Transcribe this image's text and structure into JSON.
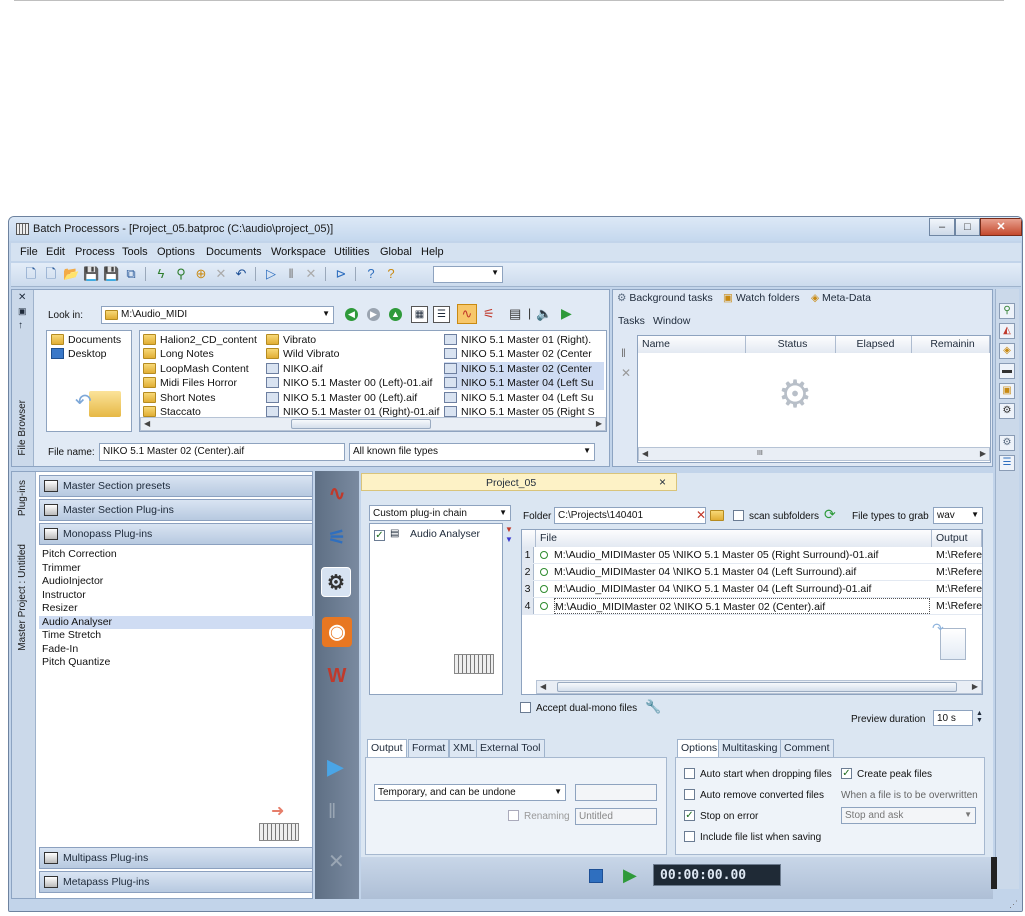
{
  "window": {
    "title": "Batch Processors - [Project_05.batproc (C:\\audio\\project_05)]",
    "min": "–",
    "max": "□",
    "close": "✕"
  },
  "menu": [
    "File",
    "Edit",
    "Process",
    "Tools",
    "Options",
    "Documents",
    "Workspace",
    "Utilities",
    "Global",
    "Help"
  ],
  "file_browser": {
    "vtab": "File Browser",
    "look_in_label": "Look in:",
    "look_in_value": "M:\\Audio_MIDI",
    "left_items": [
      "Documents",
      "Desktop"
    ],
    "col1": [
      {
        "name": "Halion2_CD_content",
        "type": "folder"
      },
      {
        "name": "Long Notes",
        "type": "folder"
      },
      {
        "name": "LoopMash Content",
        "type": "folder"
      },
      {
        "name": "Midi Files Horror",
        "type": "folder"
      },
      {
        "name": "Short Notes",
        "type": "folder"
      },
      {
        "name": "Staccato",
        "type": "folder"
      }
    ],
    "col2": [
      {
        "name": "Vibrato",
        "type": "folder"
      },
      {
        "name": "Wild Vibrato",
        "type": "folder"
      },
      {
        "name": "NIKO.aif",
        "type": "aif"
      },
      {
        "name": "NIKO 5.1 Master 00 (Left)-01.aif",
        "type": "aif"
      },
      {
        "name": "NIKO 5.1 Master 00 (Left).aif",
        "type": "aif"
      },
      {
        "name": "NIKO 5.1 Master 01 (Right)-01.aif",
        "type": "aif"
      }
    ],
    "col3": [
      {
        "name": "NIKO 5.1 Master 01 (Right).",
        "type": "aif"
      },
      {
        "name": "NIKO 5.1 Master 02 (Center",
        "type": "aif"
      },
      {
        "name": "NIKO 5.1 Master 02 (Center",
        "type": "aif",
        "selected": true
      },
      {
        "name": "NIKO 5.1 Master 04 (Left Su",
        "type": "aif",
        "selected": true
      },
      {
        "name": "NIKO 5.1 Master 04 (Left Su",
        "type": "aif"
      },
      {
        "name": "NIKO 5.1 Master 05 (Right S",
        "type": "aif"
      }
    ],
    "file_name_label": "File name:",
    "file_name_value": "NIKO 5.1 Master 02 (Center).aif",
    "file_types_value": "All known file types"
  },
  "background": {
    "tabs": [
      "Background tasks",
      "Watch folders",
      "Meta-Data"
    ],
    "submenu": [
      "Tasks",
      "Window"
    ],
    "columns": [
      "Name",
      "Status",
      "Elapsed",
      "Remainin"
    ]
  },
  "plugins": {
    "vtab_plugins": "Plug-ins",
    "vtab_project": "Master Project : Untitled",
    "groups_top": [
      "Master Section presets",
      "Master Section Plug-ins",
      "Monopass Plug-ins"
    ],
    "items": [
      "Pitch Correction",
      "Trimmer",
      "AudioInjector",
      "Instructor",
      "Resizer",
      "Audio Analyser",
      "Time Stretch",
      "Fade-In",
      "Pitch Quantize"
    ],
    "selected_item": "Audio Analyser",
    "groups_bottom": [
      "Multipass Plug-ins",
      "Metapass Plug-ins"
    ]
  },
  "project": {
    "tab_title": "Project_05",
    "tab_close": "×",
    "chain_select": "Custom plug-in chain",
    "chain_items": [
      "Audio Analyser"
    ],
    "folder_label": "Folder",
    "folder_value": "C:\\Projects\\140401",
    "scan_subfolders": "scan subfolders",
    "file_types_label": "File types to grab",
    "file_types_value": "wav",
    "columns": [
      "File",
      "Output"
    ],
    "rows": [
      {
        "n": "1",
        "file": "M:\\Audio_MIDIMaster 05 \\NIKO 5.1 Master 05 (Right Surround)-01.aif",
        "output": "M:\\Referer"
      },
      {
        "n": "2",
        "file": "M:\\Audio_MIDIMaster 04 \\NIKO 5.1 Master 04 (Left Surround).aif",
        "output": "M:\\Referer"
      },
      {
        "n": "3",
        "file": "M:\\Audio_MIDIMaster 04 \\NIKO 5.1 Master 04 (Left Surround)-01.aif",
        "output": "M:\\Referer"
      },
      {
        "n": "4",
        "file": "M:\\Audio_MIDIMaster 02 \\NIKO 5.1 Master 02 (Center).aif",
        "output": "M:\\Referer"
      }
    ],
    "accept_dual_mono": "Accept dual-mono files",
    "preview_label": "Preview duration",
    "preview_value": "10 s"
  },
  "output_panel": {
    "tabs": [
      "Output",
      "Format",
      "XML",
      "External Tool"
    ],
    "mode_value": "Temporary, and can be undone",
    "renaming_label": "Renaming",
    "renaming_value": "Untitled"
  },
  "options_panel": {
    "tabs": [
      "Options",
      "Multitasking",
      "Comment"
    ],
    "auto_start": "Auto start when dropping files",
    "create_peak": "Create peak files",
    "auto_remove": "Auto remove converted files",
    "overwrite_label": "When a file is to be overwritten",
    "stop_on_error": "Stop on error",
    "overwrite_value": "Stop and ask",
    "include_list": "Include file list when saving"
  },
  "transport": {
    "time": "00:00:00.00"
  },
  "colors": {
    "accent": "#2f6fbf",
    "window_bg": "#c2d4ea",
    "strip": "#6a7b90",
    "selected": "#cfdcf3"
  }
}
